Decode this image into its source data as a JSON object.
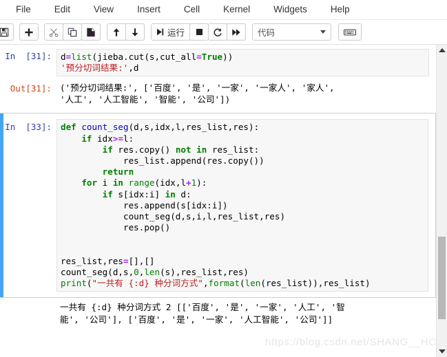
{
  "menubar": {
    "items": [
      {
        "label": "File",
        "name": "menu-file"
      },
      {
        "label": "Edit",
        "name": "menu-edit"
      },
      {
        "label": "View",
        "name": "menu-view"
      },
      {
        "label": "Insert",
        "name": "menu-insert"
      },
      {
        "label": "Cell",
        "name": "menu-cell"
      },
      {
        "label": "Kernel",
        "name": "menu-kernel"
      },
      {
        "label": "Widgets",
        "name": "menu-widgets"
      },
      {
        "label": "Help",
        "name": "menu-help"
      }
    ]
  },
  "toolbar": {
    "save_icon": "save-icon",
    "add_icon": "plus-icon",
    "cut_icon": "scissors-icon",
    "copy_icon": "copy-icon",
    "paste_icon": "paste-icon",
    "move_up_icon": "arrow-up-icon",
    "move_down_icon": "arrow-down-icon",
    "run_icon": "run-icon",
    "run_label": "运行",
    "stop_icon": "stop-square-icon",
    "restart_icon": "restart-circle-icon",
    "restart_run_all_icon": "fast-forward-icon",
    "celltype_value": "代码",
    "celltype_caret": "chevron-down-icon",
    "command_palette_icon": "keyboard-icon"
  },
  "notebook": {
    "cells": [
      {
        "type": "code",
        "prompt": "In  [31]:",
        "selected": false,
        "lines": [
          [
            {
              "t": "d",
              "c": ""
            },
            {
              "t": "=",
              "c": "op"
            },
            {
              "t": "list",
              "c": "bi"
            },
            {
              "t": "(jieba.cut(s,cut_all",
              "c": ""
            },
            {
              "t": "=",
              "c": "op"
            },
            {
              "t": "True",
              "c": "bo"
            },
            {
              "t": "))",
              "c": ""
            }
          ],
          [
            {
              "t": "'预分切词结果:'",
              "c": "st"
            },
            {
              "t": ",d",
              "c": ""
            }
          ]
        ]
      },
      {
        "type": "output",
        "prompt": "Out[31]:",
        "text": "('预分切词结果:', ['百度', '是', '一家', '一家人', '家人',\n'人工', '人工智能', '智能', '公司'])"
      },
      {
        "type": "code",
        "prompt": "In  [33]:",
        "selected": true,
        "lines": [
          [
            {
              "t": "def ",
              "c": "k"
            },
            {
              "t": "count_seg",
              "c": "fn"
            },
            {
              "t": "(d,s,idx,l,res_list,res):",
              "c": ""
            }
          ],
          [
            {
              "t": "    ",
              "c": ""
            },
            {
              "t": "if",
              "c": "k"
            },
            {
              "t": " idx",
              "c": ""
            },
            {
              "t": ">=",
              "c": "op"
            },
            {
              "t": "l:",
              "c": ""
            }
          ],
          [
            {
              "t": "        ",
              "c": ""
            },
            {
              "t": "if",
              "c": "k"
            },
            {
              "t": " res.copy() ",
              "c": ""
            },
            {
              "t": "not in",
              "c": "k"
            },
            {
              "t": " res_list:",
              "c": ""
            }
          ],
          [
            {
              "t": "            res_list.append(res.copy())",
              "c": ""
            }
          ],
          [
            {
              "t": "        ",
              "c": ""
            },
            {
              "t": "return",
              "c": "k"
            }
          ],
          [
            {
              "t": "    ",
              "c": ""
            },
            {
              "t": "for",
              "c": "k"
            },
            {
              "t": " i ",
              "c": ""
            },
            {
              "t": "in",
              "c": "k"
            },
            {
              "t": " ",
              "c": ""
            },
            {
              "t": "range",
              "c": "bi"
            },
            {
              "t": "(idx,l",
              "c": ""
            },
            {
              "t": "+",
              "c": "op"
            },
            {
              "t": "1",
              "c": "num"
            },
            {
              "t": "):",
              "c": ""
            }
          ],
          [
            {
              "t": "        ",
              "c": ""
            },
            {
              "t": "if",
              "c": "k"
            },
            {
              "t": " s[idx:i] ",
              "c": ""
            },
            {
              "t": "in",
              "c": "k"
            },
            {
              "t": " d:",
              "c": ""
            }
          ],
          [
            {
              "t": "            res.append(s[idx:i])",
              "c": ""
            }
          ],
          [
            {
              "t": "            count_seg(d,s,i,l,res_list,res)",
              "c": ""
            }
          ],
          [
            {
              "t": "            res.pop()",
              "c": ""
            }
          ],
          [
            {
              "t": "",
              "c": ""
            }
          ],
          [
            {
              "t": "",
              "c": ""
            }
          ],
          [
            {
              "t": "res_list,res",
              "c": ""
            },
            {
              "t": "=",
              "c": "op"
            },
            {
              "t": "[],[]",
              "c": ""
            }
          ],
          [
            {
              "t": "count_seg(d,s,",
              "c": ""
            },
            {
              "t": "0",
              "c": "num"
            },
            {
              "t": ",",
              "c": ""
            },
            {
              "t": "len",
              "c": "bi"
            },
            {
              "t": "(s),res_list,res)",
              "c": ""
            }
          ],
          [
            {
              "t": "print",
              "c": "bi"
            },
            {
              "t": "(",
              "c": ""
            },
            {
              "t": "\"一共有 {:d} 种分词方式\"",
              "c": "st"
            },
            {
              "t": ",",
              "c": ""
            },
            {
              "t": "format",
              "c": "bi"
            },
            {
              "t": "(",
              "c": ""
            },
            {
              "t": "len",
              "c": "bi"
            },
            {
              "t": "(res_list)),res_list)",
              "c": ""
            }
          ]
        ]
      },
      {
        "type": "stdout",
        "prompt": "",
        "text": "一共有 {:d} 种分词方式 2 [['百度', '是', '一家', '人工', '智\n能', '公司'], ['百度', '是', '一家', '人工智能', '公司']]"
      }
    ]
  },
  "scrollbar": {
    "up_icon": "triangle-up-icon",
    "down_icon": "triangle-down-icon"
  },
  "watermark": {
    "text": "https://blog.csdn.net/SHANG__HC"
  },
  "colors": {
    "selected_cell_bar": "#42a5f5",
    "in_prompt": "#303F9F",
    "out_prompt": "#D84315",
    "string": "#BA2121",
    "keyword": "#008000",
    "operator": "#AA22FF",
    "function_name": "#0000C0",
    "code_background": "#f7f7f7"
  }
}
